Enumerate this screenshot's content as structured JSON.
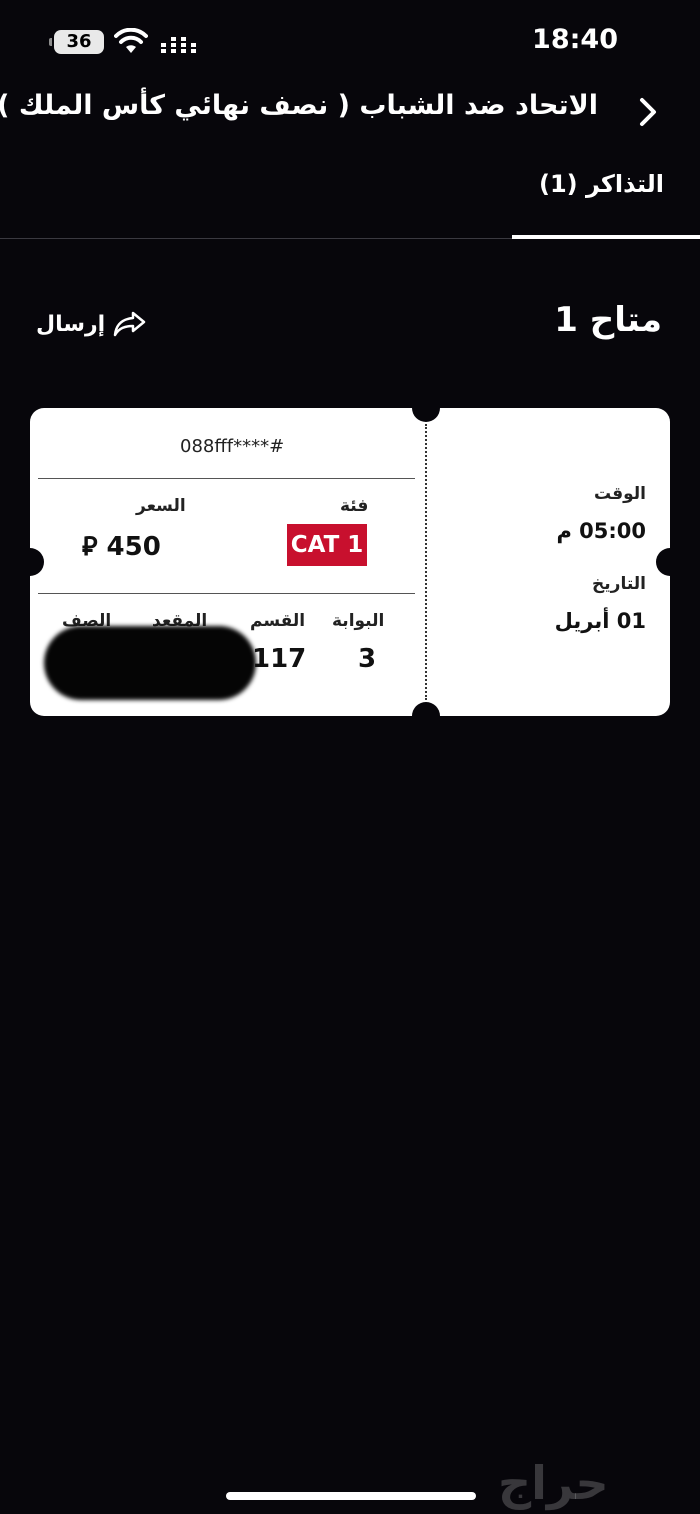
{
  "status_bar": {
    "time": "18:40",
    "battery": "36",
    "icons": [
      "battery-icon",
      "wifi-icon",
      "cellular-signal-icon"
    ]
  },
  "header": {
    "title": "الاتحاد ضد الشباب ( نصف نهائي كأس الملك )",
    "back_icon": "chevron-right-icon"
  },
  "tabs": [
    {
      "label": "التذاكر (1)",
      "active": true
    }
  ],
  "section": {
    "title": "متاح 1",
    "send_label": "إرسال",
    "send_icon": "share-arrow-icon"
  },
  "ticket": {
    "number": "088fff****#",
    "category_label": "فئة",
    "category_value": "CAT 1",
    "price_label": "السعر",
    "price_value": "450",
    "currency_symbol": "⃁",
    "gate_label": "البوابة",
    "gate_value": "3",
    "section_label": "القسم",
    "section_value": "117",
    "seat_label": "المقعد",
    "row_label": "الصف",
    "time_label": "الوقت",
    "time_value": "05:00 م",
    "date_label": "التاريخ",
    "date_value": "01 أبريل"
  },
  "watermark": "حراج",
  "colors": {
    "background": "#07060b",
    "ticket": "#ffffff",
    "category_badge": "#c8102e",
    "text_light": "#ffffff",
    "text_dark": "#111111"
  }
}
